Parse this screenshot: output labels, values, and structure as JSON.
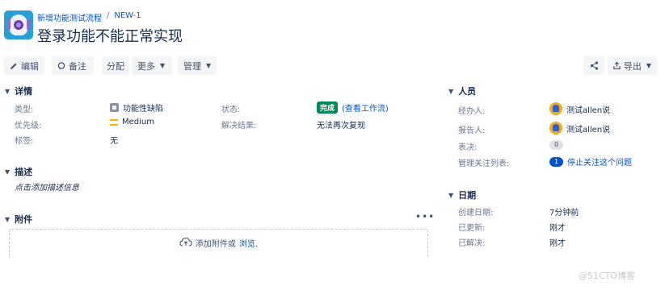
{
  "breadcrumb": {
    "project": "新增功能测试流程",
    "separator": "/",
    "issue_key": "NEW-1"
  },
  "issue": {
    "title": "登录功能不能正常实现"
  },
  "toolbar": {
    "edit": "编辑",
    "comment": "备注",
    "assign": "分配",
    "more": "更多",
    "admin": "管理",
    "export": "导出"
  },
  "details": {
    "heading": "详情",
    "type_label": "类型:",
    "type_value": "功能性缺陷",
    "priority_label": "优先级:",
    "priority_value": "Medium",
    "labels_label": "标签:",
    "labels_value": "无",
    "status_label": "状态:",
    "status_value": "完成",
    "status_link": "(查看工作流)",
    "resolution_label": "解决结果:",
    "resolution_value": "无法再次复现"
  },
  "description": {
    "heading": "描述",
    "placeholder": "点击添加描述信息"
  },
  "attachments": {
    "heading": "附件",
    "more": "•••",
    "drop_text": "添加附件或",
    "browse": "浏览."
  },
  "people": {
    "heading": "人员",
    "assignee_label": "经办人:",
    "assignee": "测试allen说",
    "reporter_label": "报告人:",
    "reporter": "测试allen说",
    "votes_label": "表决:",
    "votes": "0",
    "watchers_label": "管理关注列表:",
    "watchers": "1",
    "watch_action": "停止关注这个问题"
  },
  "dates": {
    "heading": "日期",
    "created_label": "创建日期:",
    "created": "7分钟前",
    "updated_label": "已更新:",
    "updated": "刚才",
    "resolved_label": "已解决:",
    "resolved": "刚才"
  },
  "watermark": "@51CTO博客"
}
